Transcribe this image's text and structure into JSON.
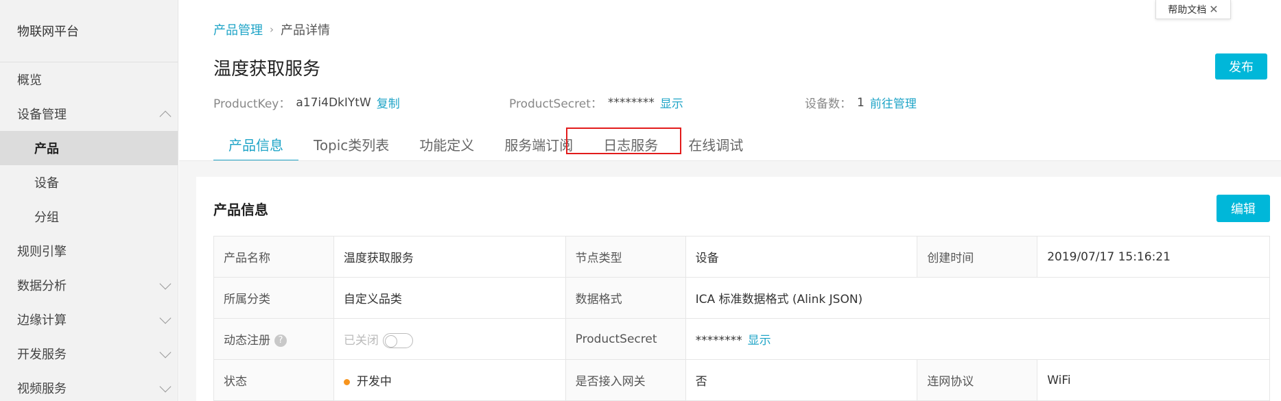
{
  "sidebar": {
    "title": "物联网平台",
    "items": [
      {
        "label": "概览"
      },
      {
        "label": "设备管理"
      },
      {
        "label": "产品"
      },
      {
        "label": "设备"
      },
      {
        "label": "分组"
      },
      {
        "label": "规则引擎"
      },
      {
        "label": "数据分析"
      },
      {
        "label": "边缘计算"
      },
      {
        "label": "开发服务"
      },
      {
        "label": "视频服务"
      }
    ]
  },
  "help": {
    "label": "帮助文档",
    "close": "✕"
  },
  "breadcrumb": {
    "parent": "产品管理",
    "separator": "›",
    "current": "产品详情"
  },
  "header": {
    "title": "温度获取服务",
    "publish_label": "发布",
    "product_key_label": "ProductKey：",
    "product_key_value": "a17i4DkIYtW",
    "copy_label": "复制",
    "product_secret_label": "ProductSecret：",
    "product_secret_value": "********",
    "show_label": "显示",
    "device_count_label": "设备数：",
    "device_count_value": "1",
    "manage_label": "前往管理"
  },
  "tabs": [
    "产品信息",
    "Topic类列表",
    "功能定义",
    "服务端订阅",
    "日志服务",
    "在线调试"
  ],
  "card": {
    "title": "产品信息",
    "edit_label": "编辑",
    "rows": [
      [
        "产品名称",
        "温度获取服务",
        "节点类型",
        "设备",
        "创建时间",
        "2019/07/17 15:16:21"
      ],
      [
        "所属分类",
        "自定义品类",
        "数据格式",
        "ICA 标准数据格式 (Alink JSON)"
      ],
      [
        "动态注册",
        "已关闭",
        "ProductSecret",
        "********",
        "显示"
      ],
      [
        "状态",
        "开发中",
        "是否接入网关",
        "否",
        "连网协议",
        "WiFi"
      ]
    ]
  },
  "colors": {
    "accent": "#00b7d9",
    "link": "#1fa4c7",
    "highlight": "#e21b1b",
    "status_dev": "#f7941d"
  }
}
